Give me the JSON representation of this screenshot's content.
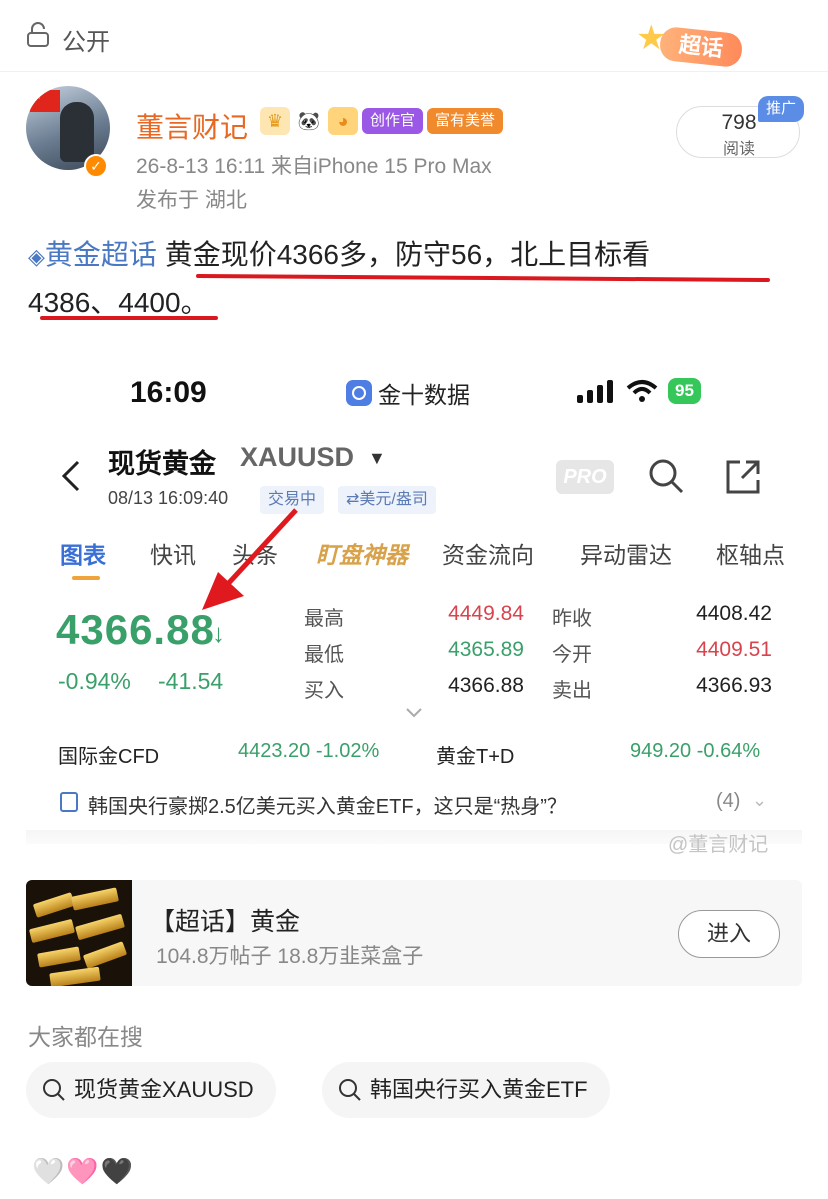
{
  "topbar": {
    "visibility_label": "公开",
    "badge_label": "超话"
  },
  "post": {
    "username": "董言财记",
    "tags": [
      "创作官",
      "富有美誉"
    ],
    "time_source": "26-8-13 16:11  来自iPhone 15 Pro Max",
    "location": "发布于 湖北",
    "read_count": "798",
    "read_label": "阅读",
    "promo_tag": "推广",
    "topic_link": "黄金超话",
    "text_line1": "黄金现价4366多，防守56，北上目标看",
    "text_line2": "4386、4400",
    "text_line2_tail": "。"
  },
  "screenshot": {
    "status_time": "16:09",
    "app_name": "金十数据",
    "battery": "95",
    "instrument_name": "现货黄金",
    "instrument_code": "XAUUSD",
    "datetime": "08/13 16:09:40",
    "chip_trading": "交易中",
    "chip_unit": "⇄美元/盎司",
    "pro_label": "PRO",
    "tabs": [
      "图表",
      "快讯",
      "头条",
      "盯盘神器",
      "资金流向",
      "异动雷达",
      "枢轴点"
    ],
    "price": "4366.88",
    "change_pct": "-0.94%",
    "change_abs": "-41.54",
    "stats": {
      "high_label": "最高",
      "high": "4449.84",
      "low_label": "最低",
      "low": "4365.89",
      "buy_label": "买入",
      "buy": "4366.88",
      "prev_label": "昨收",
      "prev": "4408.42",
      "open_label": "今开",
      "open": "4409.51",
      "sell_label": "卖出",
      "sell": "4366.93"
    },
    "market1_name": "国际金CFD",
    "market1_value": "4423.20  -1.02%",
    "market2_name": "黄金T+D",
    "market2_value": "949.20  -0.64%",
    "news_text": "韩国央行豪掷2.5亿美元买入黄金ETF，这只是“热身”？",
    "news_count": "(4)",
    "watermark": "@董言财记"
  },
  "supertopic": {
    "title": "【超话】黄金",
    "subtitle": "104.8万帖子 18.8万韭菜盒子",
    "enter_label": "进入"
  },
  "searches": {
    "title": "大家都在搜",
    "items": [
      "现货黄金XAUUSD",
      "韩国央行买入黄金ETF"
    ]
  },
  "hearts": "🤍🩷🖤",
  "colors": {
    "up": "#d8434d",
    "down": "#3aa06a",
    "accent": "#3a6fd8",
    "username": "#e86722",
    "underline": "#d9191f"
  }
}
